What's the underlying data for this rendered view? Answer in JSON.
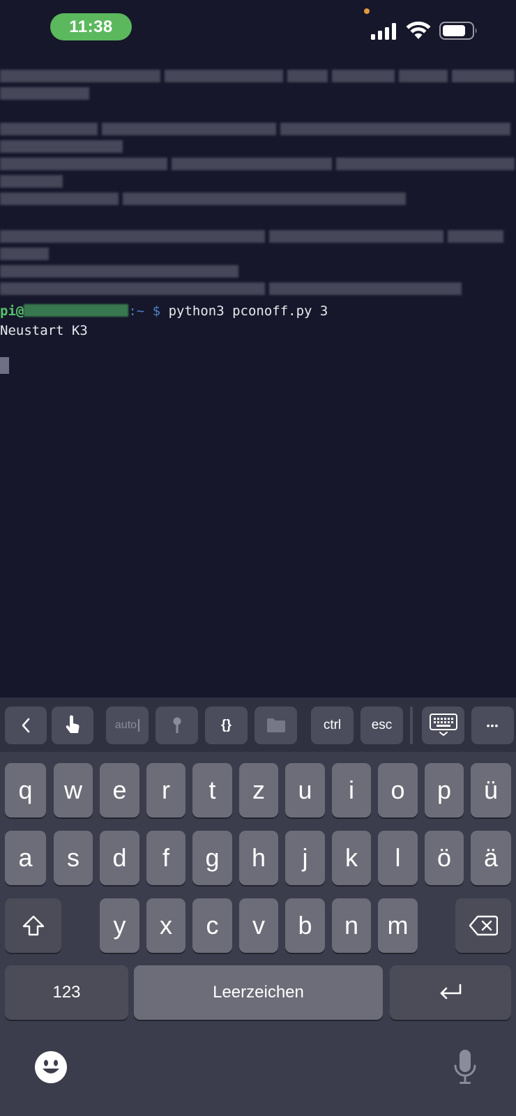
{
  "status_bar": {
    "time": "11:38",
    "icons": [
      "cellular-signal-icon",
      "wifi-icon",
      "battery-icon"
    ]
  },
  "terminal": {
    "prompt_user": "pi@",
    "prompt_sep": ":~",
    "prompt_dollar": "$",
    "command": " python3 pconoff.py 3",
    "output": "Neustart K3"
  },
  "toolbar": {
    "back_icon": "chevron-left-icon",
    "touch_icon": "tap-gesture-icon",
    "auto_label": "auto",
    "key_icon": "key-icon",
    "braces_label": "{}",
    "folder_icon": "folder-icon",
    "ctrl_label": "ctrl",
    "esc_label": "esc",
    "keyboard_icon": "keyboard-hide-icon",
    "more_label": "•••"
  },
  "keyboard": {
    "row1": [
      "q",
      "w",
      "e",
      "r",
      "t",
      "z",
      "u",
      "i",
      "o",
      "p",
      "ü"
    ],
    "row2": [
      "a",
      "s",
      "d",
      "f",
      "g",
      "h",
      "j",
      "k",
      "l",
      "ö",
      "ä"
    ],
    "row3": [
      "y",
      "x",
      "c",
      "v",
      "b",
      "n",
      "m"
    ],
    "numbers_label": "123",
    "space_label": "Leerzeichen",
    "shift_icon": "shift-icon",
    "delete_icon": "backspace-icon",
    "return_icon": "return-icon",
    "emoji_icon": "emoji-icon",
    "mic_icon": "microphone-icon"
  },
  "colors": {
    "terminal_bg": "#16172a",
    "prompt_green": "#58c26a",
    "prompt_blue": "#4f7fc4",
    "time_pill": "#5bb85d"
  }
}
